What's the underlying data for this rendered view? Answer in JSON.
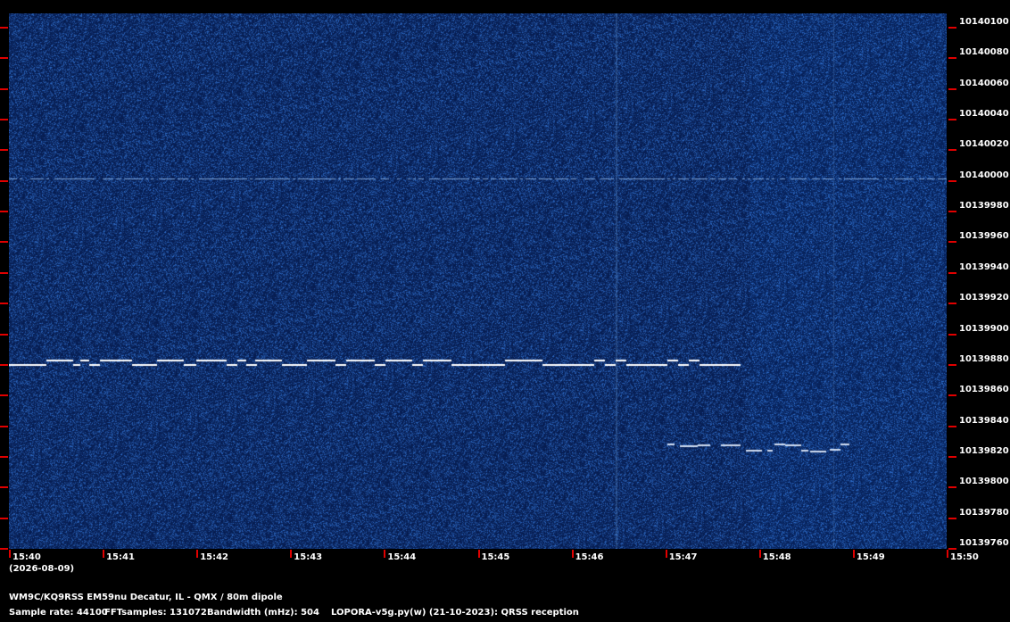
{
  "frequency_axis": {
    "labels": [
      "10140100",
      "10140080",
      "10140060",
      "10140040",
      "10140020",
      "10140000",
      "10139980",
      "10139960",
      "10139940",
      "10139920",
      "10139900",
      "10139880",
      "10139860",
      "10139840",
      "10139820",
      "10139800",
      "10139780",
      "10139760"
    ]
  },
  "time_axis": {
    "labels": [
      "15:40",
      "15:41",
      "15:42",
      "15:43",
      "15:44",
      "15:45",
      "15:46",
      "15:47",
      "15:48",
      "15:49",
      "15:50"
    ],
    "date": "(2026-08-09)"
  },
  "station": "WM9C/KQ9RSS EM59nu Decatur, IL - QMX / 80m dipole",
  "sample_rate": "Sample rate: 44100",
  "fft_samples": "FFTsamples: 131072",
  "bandwidth": "Bandwidth (mHz): 504",
  "software": "LOPORA-v5g.py(w) (21-10-2023): QRSS reception",
  "colors": {
    "background": "#0a2659",
    "noise_light": "#2a5fa8",
    "signal": "#ffffff",
    "tick": "#e00000",
    "text": "#ffffff"
  }
}
